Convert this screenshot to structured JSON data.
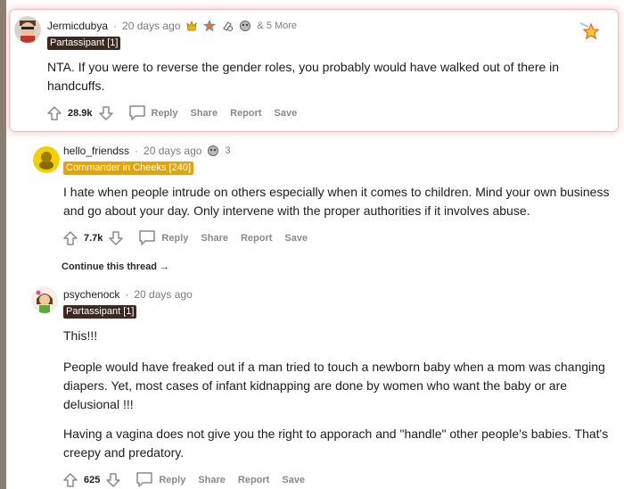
{
  "comments": [
    {
      "username": "Jermicdubya",
      "time": "20 days ago",
      "awards_more": "& 5 More",
      "flair": "Partassipant [1]",
      "paragraphs": [
        "NTA. If you were to reverse the gender roles, you probably would have walked out of there in handcuffs."
      ],
      "votes": "28.9k"
    },
    {
      "username": "hello_friendss",
      "time": "20 days ago",
      "award_count": "3",
      "flair": "Commander in Cheeks [240]",
      "paragraphs": [
        "I hate when people intrude on others especially when it comes to children. Mind your own business and go about your day. Only intervene with the proper authorities if it involves abuse."
      ],
      "votes": "7.7k"
    },
    {
      "username": "psychenock",
      "time": "20 days ago",
      "flair": "Partassipant [1]",
      "paragraphs": [
        "This!!!",
        "People would have freaked out if a man tried to touch a newborn baby when a mom was changing diapers. Yet, most cases of infant kidnapping are done by women who want the baby or are delusional !!!",
        "Having a vagina does not give you the right to apporach and \"handle\" other people's babies. That's creepy and predatory."
      ],
      "votes": "625"
    }
  ],
  "actions": {
    "reply": "Reply",
    "share": "Share",
    "report": "Report",
    "save": "Save"
  },
  "continue_thread": "Continue this thread",
  "separator": "·",
  "icons": [
    "upvote-icon",
    "downvote-icon",
    "comment-bubble-icon",
    "award-icon",
    "arrow-right-icon"
  ],
  "colors": {
    "highlight": "#f28b8b",
    "flair_dark": "#3c2a22",
    "flair_orange": "#e6a400",
    "meta_gray": "#7c7c7c"
  }
}
